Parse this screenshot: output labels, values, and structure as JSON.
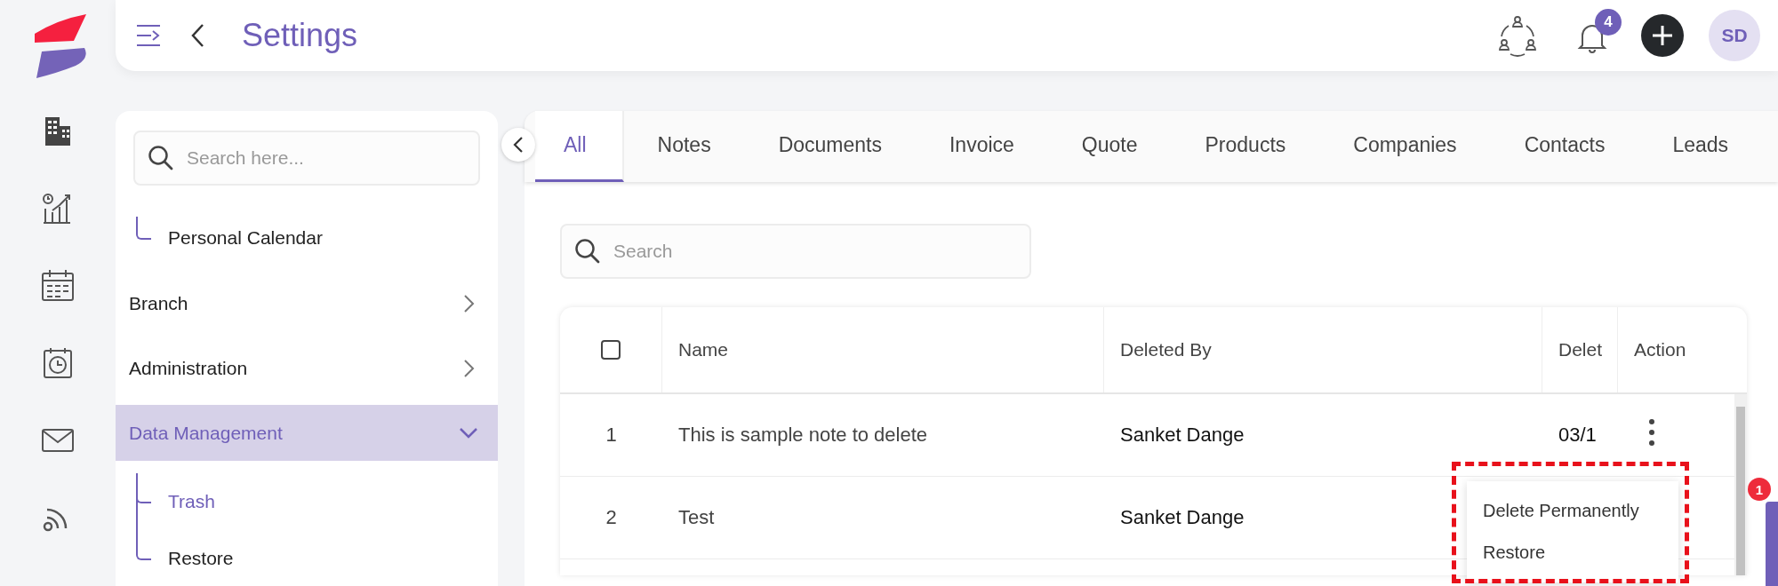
{
  "header": {
    "title": "Settings",
    "notification_count": "4",
    "avatar_initials": "SD"
  },
  "settings_sidebar": {
    "search": {
      "placeholder": "Search here..."
    },
    "scrolled_children": [
      {
        "label": "Personal Calendar",
        "selected": false
      }
    ],
    "items": [
      {
        "label": "Branch",
        "expanded": false,
        "selected": false
      },
      {
        "label": "Administration",
        "expanded": false,
        "selected": false
      },
      {
        "label": "Data Management",
        "expanded": true,
        "selected": true,
        "children": [
          {
            "label": "Trash",
            "selected": true
          },
          {
            "label": "Restore",
            "selected": false
          }
        ]
      }
    ]
  },
  "tabs": [
    {
      "label": "All",
      "selected": true
    },
    {
      "label": "Notes",
      "selected": false
    },
    {
      "label": "Documents",
      "selected": false
    },
    {
      "label": "Invoice",
      "selected": false
    },
    {
      "label": "Quote",
      "selected": false
    },
    {
      "label": "Products",
      "selected": false
    },
    {
      "label": "Companies",
      "selected": false
    },
    {
      "label": "Contacts",
      "selected": false
    },
    {
      "label": "Leads",
      "selected": false
    }
  ],
  "trash_search": {
    "placeholder": "Search"
  },
  "table": {
    "select_all_checked": false,
    "columns": [
      "Name",
      "Deleted By",
      "Delet",
      "Action"
    ],
    "rows": [
      {
        "index": "1",
        "name": "This is sample note to delete",
        "deleted_by": "Sanket Dange",
        "column_4": "03/1"
      },
      {
        "index": "2",
        "name": "Test",
        "deleted_by": "Sanket Dange"
      }
    ]
  },
  "action_menu": {
    "items": [
      "Delete Permanently",
      "Restore"
    ]
  },
  "side_tab": {
    "badge": "1"
  }
}
